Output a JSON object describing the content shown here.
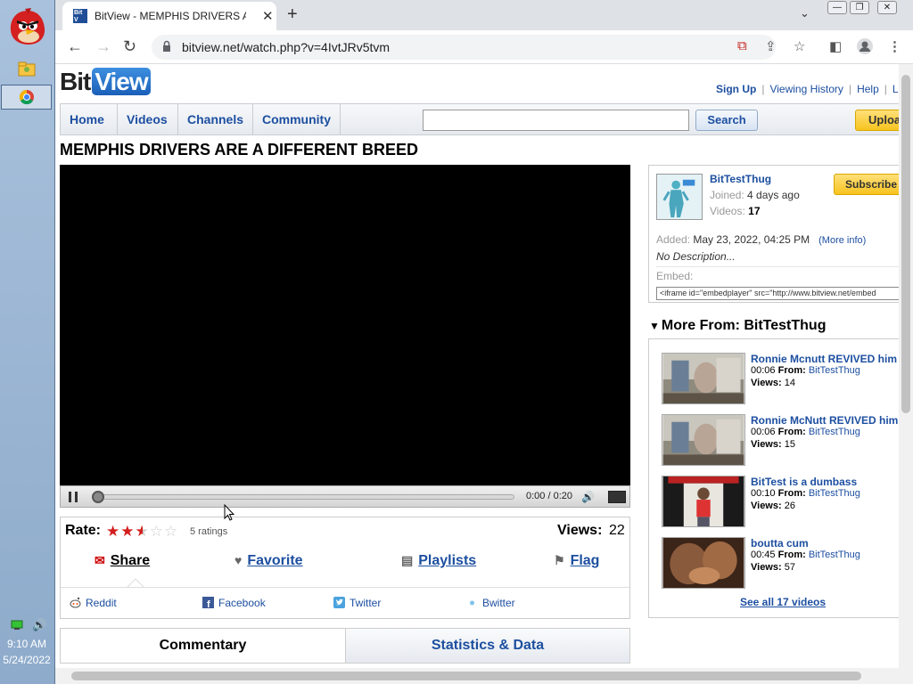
{
  "taskbar": {
    "time": "9:10 AM",
    "date": "5/24/2022"
  },
  "browser": {
    "tab_title": "BitView - MEMPHIS DRIVERS AR",
    "url": "bitview.net/watch.php?v=4IvtJRv5tvm"
  },
  "site": {
    "logo_bit": "Bit",
    "logo_view": "View",
    "top_links": [
      "Sign Up",
      "Viewing History",
      "Help",
      "Lo"
    ],
    "nav": [
      "Home",
      "Videos",
      "Channels",
      "Community"
    ],
    "search_label": "Search",
    "search_value": "",
    "upload_label": "Upload"
  },
  "video": {
    "title": "MEMPHIS DRIVERS ARE A DIFFERENT BREED",
    "time": "0:00 / 0:20",
    "progress": 0.0
  },
  "rating": {
    "label": "Rate:",
    "stars": 2.5,
    "max": 5,
    "count": "5 ratings",
    "views_label": "Views:",
    "views": "22"
  },
  "actions": {
    "share": "Share",
    "favorite": "Favorite",
    "playlists": "Playlists",
    "flag": "Flag"
  },
  "social": [
    "Reddit",
    "Facebook",
    "Twitter",
    "Bwitter"
  ],
  "tabs": {
    "commentary": "Commentary",
    "stats": "Statistics & Data"
  },
  "channel": {
    "name": "BitTestThug",
    "joined_label": "Joined:",
    "joined": "4 days ago",
    "videos_label": "Videos:",
    "videos": "17",
    "subscribe": "Subscribe",
    "added_label": "Added:",
    "added": "May 23, 2022, 04:25 PM",
    "more_info": "(More info)",
    "description": "No Description...",
    "embed_label": "Embed:",
    "embed_code": "<iframe id=\"embedplayer\" src=\"http://www.bitview.net/embed"
  },
  "more_from": {
    "header": "More From: BitTestThug",
    "from_label": "From:",
    "views_label": "Views:",
    "items": [
      {
        "title": "Ronnie Mcnutt REVIVED him",
        "duration": "00:06",
        "channel": "BitTestThug",
        "views": "14"
      },
      {
        "title": "Ronnie McNutt REVIVED him",
        "duration": "00:06",
        "channel": "BitTestThug",
        "views": "15"
      },
      {
        "title": "BitTest is a dumbass",
        "duration": "00:10",
        "channel": "BitTestThug",
        "views": "26"
      },
      {
        "title": "boutta cum",
        "duration": "00:45",
        "channel": "BitTestThug",
        "views": "57"
      }
    ],
    "see_all": "See all 17 videos"
  }
}
